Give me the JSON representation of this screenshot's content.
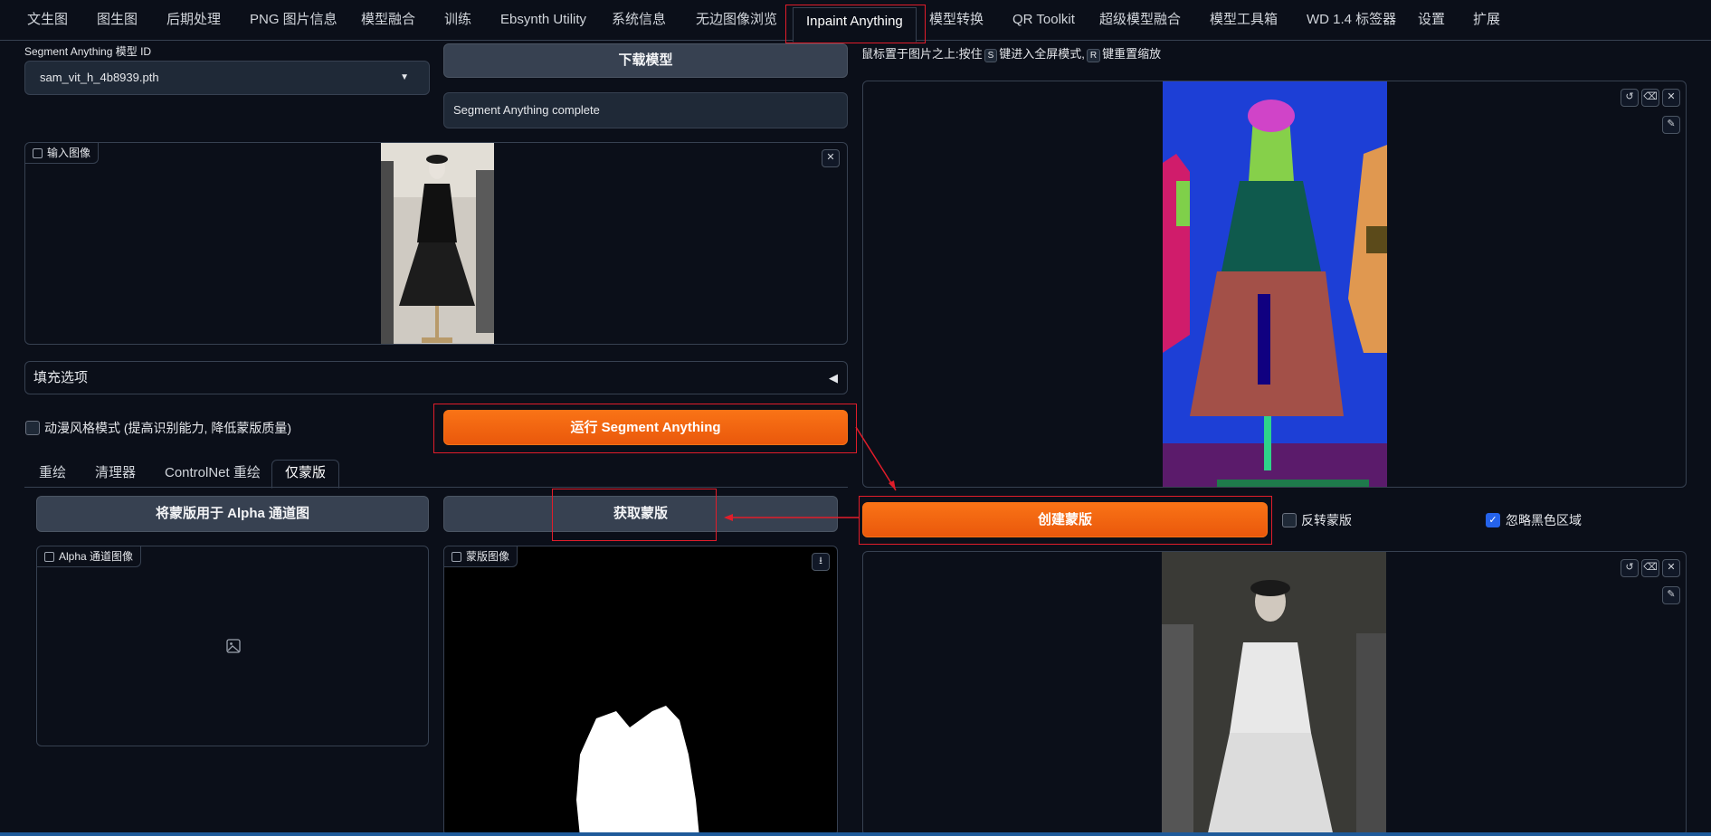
{
  "topnav": {
    "tabs": [
      "文生图",
      "图生图",
      "后期处理",
      "PNG 图片信息",
      "模型融合",
      "训练",
      "Ebsynth Utility",
      "系统信息",
      "无边图像浏览",
      "Inpaint Anything",
      "模型转换",
      "QR Toolkit",
      "超级模型融合",
      "模型工具箱",
      "WD 1.4 标签器",
      "设置",
      "扩展"
    ]
  },
  "left": {
    "model_label": "Segment Anything 模型 ID",
    "model_value": "sam_vit_h_4b8939.pth",
    "download_button": "下载模型",
    "status_text": "Segment Anything complete",
    "input_image_label": "输入图像",
    "fill_options_label": "填充选项",
    "anime_checkbox_label": "动漫风格模式 (提高识别能力, 降低蒙版质量)",
    "run_button": "运行 Segment Anything",
    "subtabs": [
      "重绘",
      "清理器",
      "ControlNet 重绘",
      "仅蒙版"
    ],
    "alpha_button": "将蒙版用于 Alpha 通道图",
    "get_mask_button": "获取蒙版",
    "alpha_image_label": "Alpha 通道图像",
    "mask_image_label": "蒙版图像"
  },
  "right": {
    "hint_prefix": "鼠标置于图片之上:按住",
    "hint_key1": "S",
    "hint_mid": "键进入全屏模式,",
    "hint_key2": "R",
    "hint_suffix": "键重置缩放",
    "create_mask_button": "创建蒙版",
    "invert_label": "反转蒙版",
    "invert_checked": false,
    "ignore_black_label": "忽略黑色区域",
    "ignore_black_checked": true
  },
  "colors": {
    "accent_orange": "#f97316",
    "highlight_red": "#e11d2a",
    "background": "#0b0f19"
  }
}
